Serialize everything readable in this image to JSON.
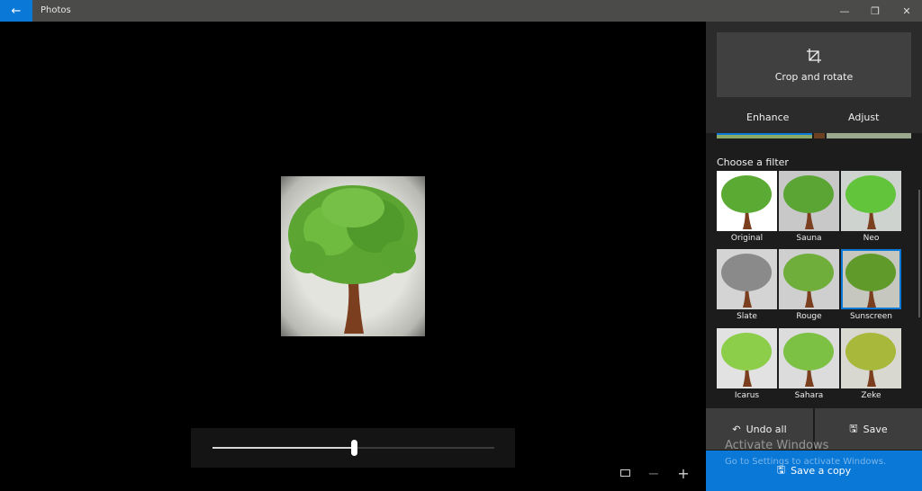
{
  "app": {
    "title": "Photos"
  },
  "window_controls": {
    "minimize": "—",
    "restore": "❐",
    "close": "✕"
  },
  "editor": {
    "crop_label": "Crop and rotate",
    "tabs": [
      {
        "label": "Enhance",
        "active": true
      },
      {
        "label": "Adjust",
        "active": false
      }
    ],
    "filters_title": "Choose a filter",
    "filters": [
      {
        "label": "Original",
        "tint": "#ffffff",
        "leaf": "#5aaa34"
      },
      {
        "label": "Sauna",
        "tint": "#c8c8c8",
        "leaf": "#5aa534"
      },
      {
        "label": "Neo",
        "tint": "#cfd3d0",
        "leaf": "#62c43a"
      },
      {
        "label": "Slate",
        "tint": "#d4d4d4",
        "leaf": "#8a8a8a"
      },
      {
        "label": "Rouge",
        "tint": "#cfcfcf",
        "leaf": "#6fae3a"
      },
      {
        "label": "Sunscreen",
        "tint": "#c6c8bf",
        "leaf": "#5f9a2a",
        "selected": true
      },
      {
        "label": "Icarus",
        "tint": "#e2e2e2",
        "leaf": "#8ccd4a"
      },
      {
        "label": "Sahara",
        "tint": "#dcdcdc",
        "leaf": "#7cc044"
      },
      {
        "label": "Zeke",
        "tint": "#d8d8d0",
        "leaf": "#a8b83a"
      }
    ],
    "filter_intensity_percent": 50,
    "undo_label": "Undo all",
    "save_label": "Save",
    "save_copy_label": "Save a copy"
  },
  "watermark": {
    "title": "Activate Windows",
    "subtitle": "Go to Settings to activate Windows."
  },
  "colors": {
    "accent": "#0a78d7"
  }
}
